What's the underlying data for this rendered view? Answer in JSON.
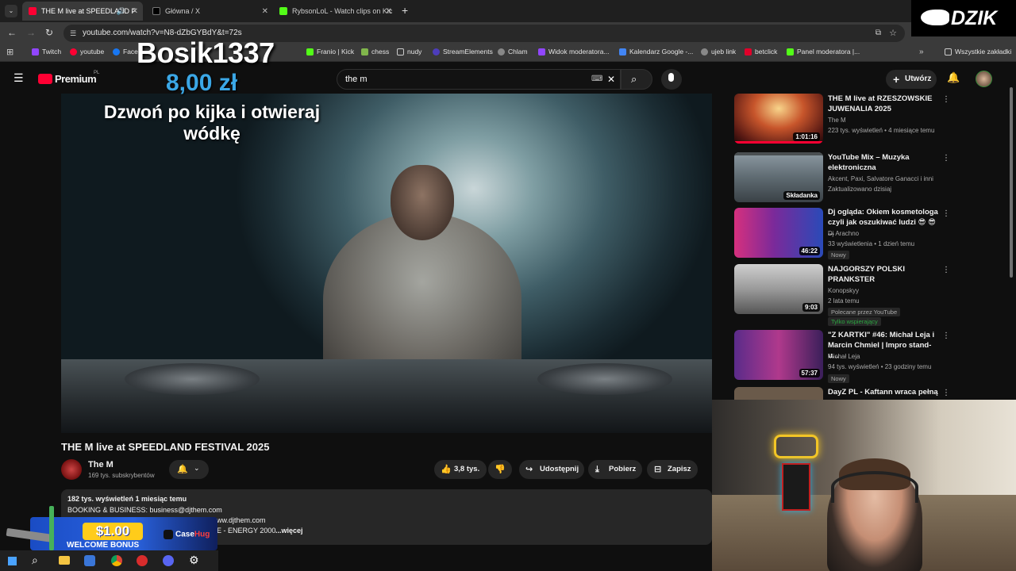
{
  "browser": {
    "tabs": [
      {
        "title": "THE M live at SPEEDLAND F",
        "active": true
      },
      {
        "title": "Główna / X",
        "active": false
      },
      {
        "title": "RybsonLoL - Watch clips on Kic",
        "active": false
      }
    ],
    "new_tab": "+",
    "url": "youtube.com/watch?v=N8-dZbGYBdY&t=72s",
    "bookmarks": [
      "Twitch",
      "youtube",
      "Face",
      "Franio | Kick",
      "chess",
      "nudy",
      "StreamElements",
      "Chlam",
      "Widok moderatora...",
      "Kalendarz Google -...",
      "ujeb link",
      "betclick",
      "Panel moderatora |..."
    ],
    "all_bookmarks": "Wszystkie zakładki"
  },
  "youtube": {
    "logo": "Premium",
    "region": "PL",
    "search_value": "the m",
    "create": "Utwórz"
  },
  "donation": {
    "donor": "Bosik1337",
    "amount": "8,00 zł",
    "message": "Dzwoń po kijka i otwieraj wódkę"
  },
  "streamer_logo": "DZIK",
  "video": {
    "title": "THE M live at SPEEDLAND FESTIVAL 2025",
    "channel": "The M",
    "subscribers": "169 tys. subskrybentów",
    "likes": "3,8 tys.",
    "share": "Udostępnij",
    "download": "Pobierz",
    "save": "Zapisz",
    "description": {
      "stats": "182 tys. wyświetleń  1 miesiąc temu",
      "line1": "BOOKING & BUSINESS: business@djthem.com",
      "line2": "ww.djthem.com",
      "line3": "E - ENERGY 2000",
      "more": "...więcej"
    }
  },
  "recommendations": [
    {
      "title": "THE M live at RZESZOWSKIE JUWENALIA 2025",
      "channel": "The M",
      "meta": "223 tys. wyświetleń • 4 miesiące temu",
      "duration": "1:01:16",
      "badges": []
    },
    {
      "title": "YouTube Mix – Muzyka elektroniczna",
      "channel": "Akcent, Paxi, Salvatore Ganacci i inni",
      "meta": "Zaktualizowano dzisiaj",
      "duration": "Składanka",
      "badges": []
    },
    {
      "title": "Dj ogląda: Okiem kosmetologa czyli jak oszukiwać ludzi 😎 😎 ...",
      "channel": "Dj Arachno",
      "meta": "33 wyświetlenia • 1 dzień temu",
      "duration": "46:22",
      "badges": [
        "Nowy"
      ]
    },
    {
      "title": "NAJGORSZY POLSKI PRANKSTER",
      "channel": "Konopskyy",
      "meta": "2 lata temu",
      "duration": "9:03",
      "badges": [
        "Polecane przez YouTube",
        "Tylko wspierający"
      ]
    },
    {
      "title": "\"Z KARTKI\" #46: Michał Leja i Marcin Chmiel | Impro stand-u...",
      "channel": "Michał Leja",
      "meta": "94 tys. wyświetleń • 23 godziny temu",
      "duration": "57:37",
      "badges": [
        "Nowy"
      ]
    },
    {
      "title": "DayZ PL - Kaftann wraca pełną",
      "channel": "",
      "meta": "",
      "duration": "",
      "badges": []
    }
  ],
  "ad": {
    "amount": "$1.00",
    "bonus": "WELCOME BONUS",
    "brand_a": "Case",
    "brand_b": "Hug"
  },
  "colors": {
    "accent_red": "#ff0033",
    "donation_blue": "#3ba7e6",
    "ad_yellow": "#ffcc1a"
  }
}
